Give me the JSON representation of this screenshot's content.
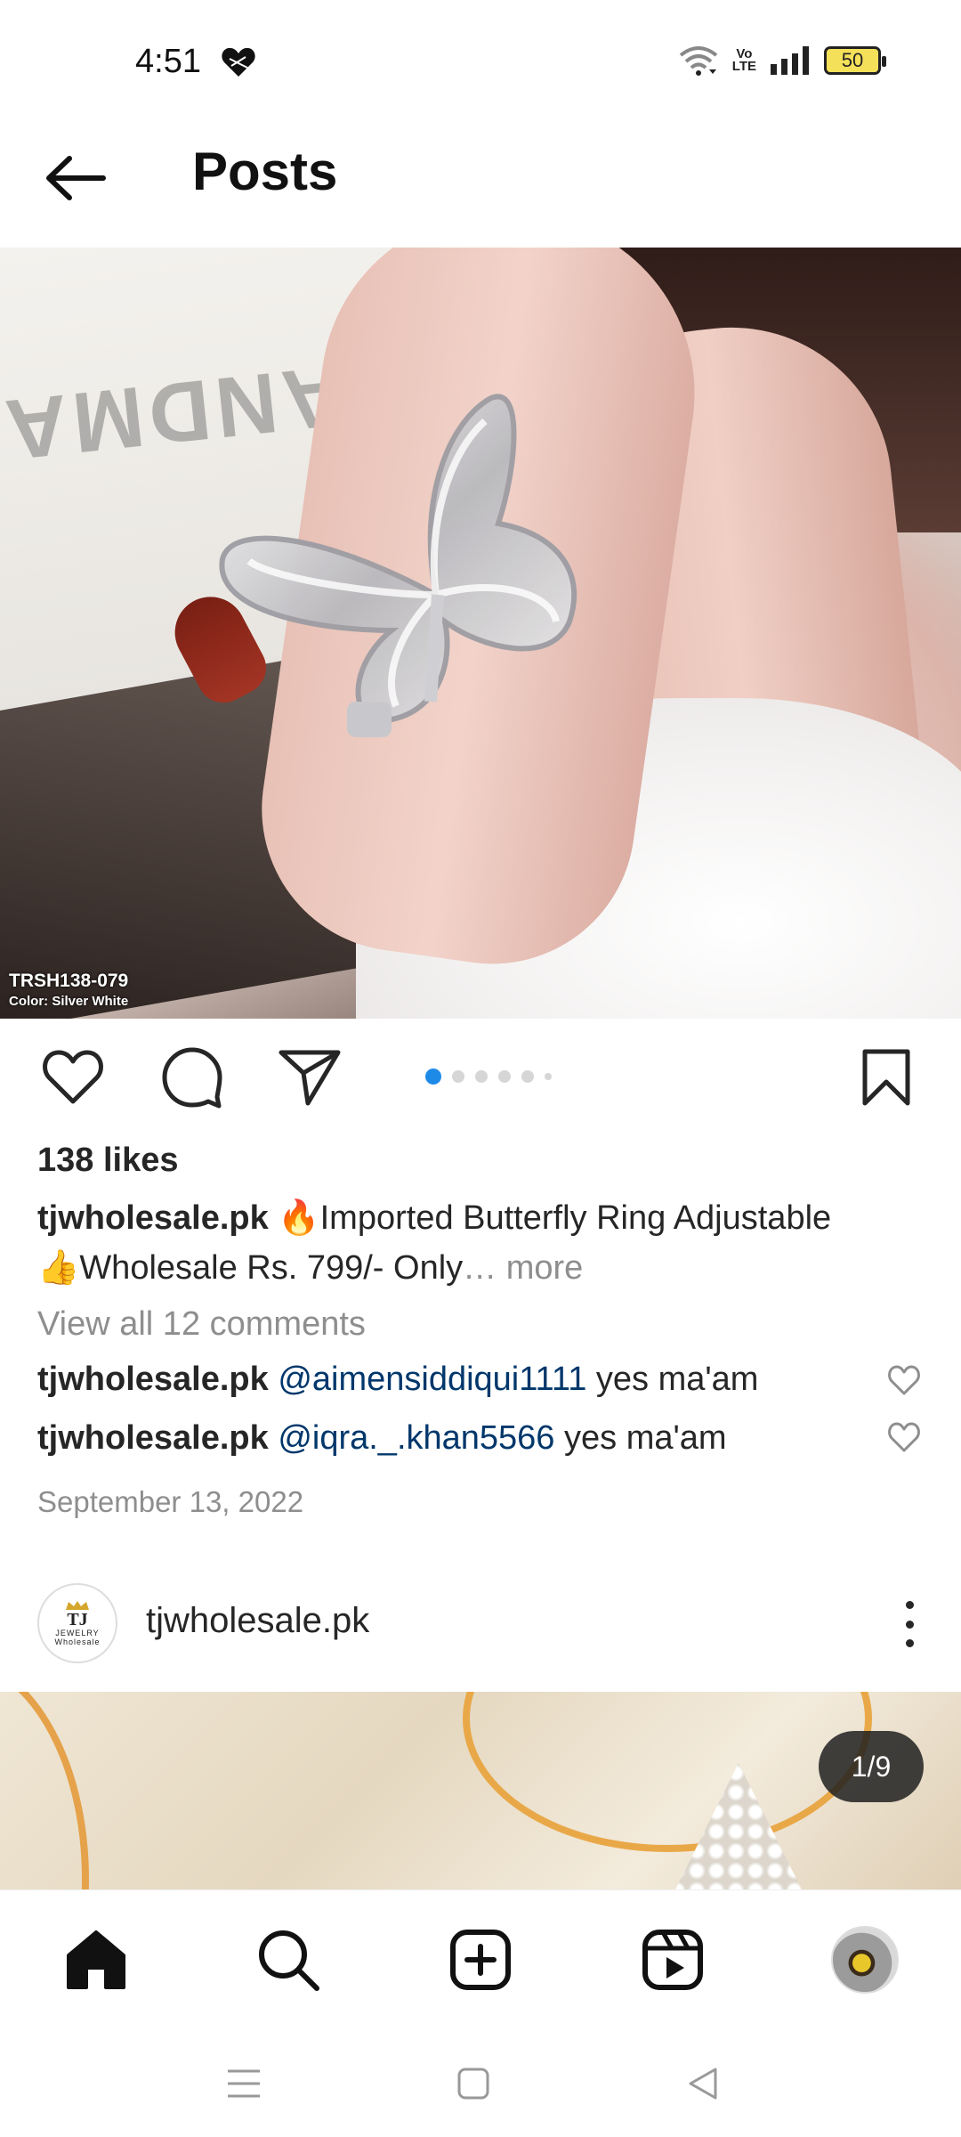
{
  "status_bar": {
    "time": "4:51",
    "battery": "50",
    "volte_top": "Vo",
    "volte_bottom": "LTE"
  },
  "header": {
    "title": "Posts"
  },
  "post": {
    "sku": "TRSH138-079",
    "sku_color": "Color: Silver White",
    "image_watermark": "ANDMA",
    "carousel": {
      "total_dots": 6,
      "active_index": 0
    },
    "likes": "138 likes",
    "caption": {
      "username": "tjwholesale.pk",
      "text_line1": "🔥Imported Butterfly Ring Adjustable",
      "text_line2": "👍Wholesale Rs. 799/- Only",
      "ellipsis": "…",
      "more": " more"
    },
    "view_comments": "View all 12 comments",
    "comments": [
      {
        "username": "tjwholesale.pk",
        "mention": "@aimensiddiqui1111",
        "text": "yes ma'am"
      },
      {
        "username": "tjwholesale.pk",
        "mention": "@iqra._.khan5566",
        "text": "yes ma'am"
      }
    ],
    "date": "September 13, 2022"
  },
  "post2": {
    "username": "tjwholesale.pk",
    "avatar_logo": "TJ",
    "avatar_logo_sub": "JEWELRY",
    "avatar_logo_tag": "Wholesale",
    "image_counter": "1/9"
  },
  "bottom_nav": {
    "items": [
      "home-icon",
      "search-icon",
      "create-icon",
      "reels-icon",
      "profile-avatar"
    ]
  },
  "colors": {
    "text": "#262626",
    "secondary": "#8e8e8e",
    "mention": "#00376b",
    "carousel_active": "#1e8ae8"
  }
}
